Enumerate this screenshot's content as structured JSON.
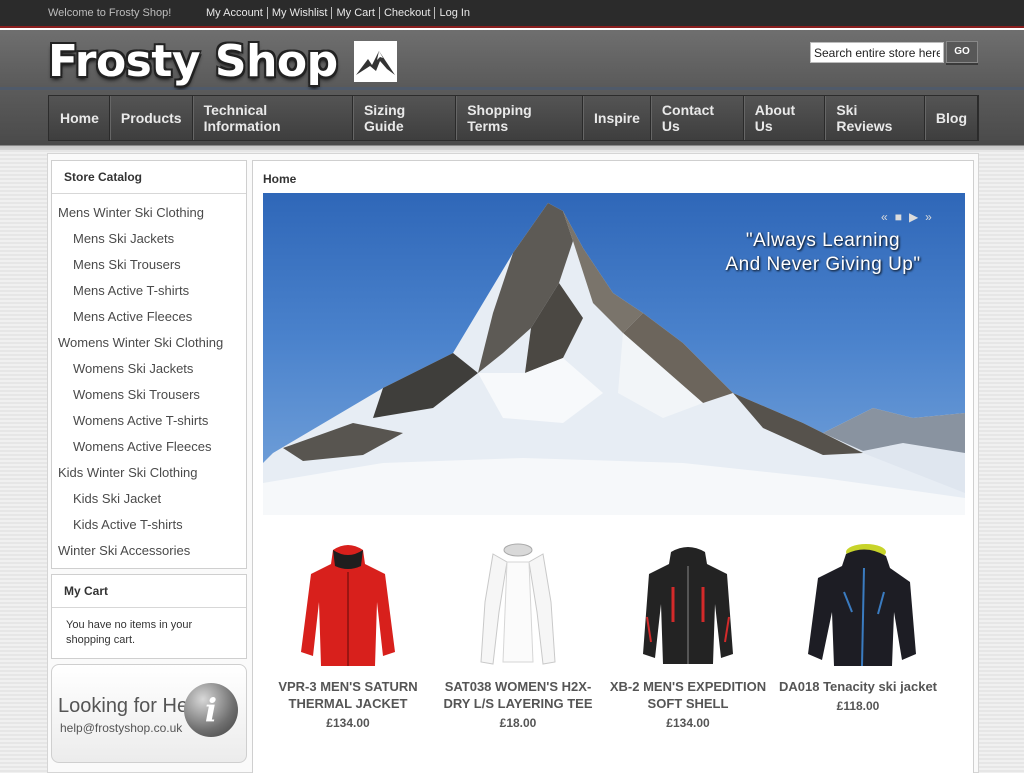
{
  "topbar": {
    "welcome": "Welcome to Frosty Shop!",
    "links": [
      "My Account",
      "My Wishlist",
      "My Cart",
      "Checkout",
      "Log In"
    ]
  },
  "header": {
    "logo_text": "Frosty Shop",
    "search_placeholder": "Search entire store here...",
    "search_value": "Search entire store here",
    "search_button": "GO"
  },
  "nav": {
    "items": [
      "Home",
      "Products",
      "Technical Information",
      "Sizing Guide",
      "Shopping Terms",
      "Inspire",
      "Contact Us",
      "About Us",
      "Ski Reviews",
      "Blog"
    ]
  },
  "sidebar": {
    "catalog_title": "Store Catalog",
    "catalog": [
      {
        "label": "Mens Winter Ski Clothing",
        "level": "top"
      },
      {
        "label": "Mens Ski Jackets",
        "level": "sub"
      },
      {
        "label": "Mens Ski Trousers",
        "level": "sub"
      },
      {
        "label": "Mens Active T-shirts",
        "level": "sub"
      },
      {
        "label": "Mens Active Fleeces",
        "level": "sub"
      },
      {
        "label": "Womens Winter Ski Clothing",
        "level": "top"
      },
      {
        "label": "Womens Ski Jackets",
        "level": "sub"
      },
      {
        "label": "Womens Ski Trousers",
        "level": "sub"
      },
      {
        "label": "Womens Active T-shirts",
        "level": "sub"
      },
      {
        "label": "Womens Active Fleeces",
        "level": "sub"
      },
      {
        "label": "Kids Winter Ski Clothing",
        "level": "top"
      },
      {
        "label": "Kids Ski Jacket",
        "level": "sub"
      },
      {
        "label": "Kids Active T-shirts",
        "level": "sub"
      },
      {
        "label": "Winter Ski Accessories",
        "level": "top"
      }
    ],
    "cart_title": "My Cart",
    "cart_text": "You have no items in your shopping cart.",
    "help_title": "Looking for Help",
    "help_email": "help@frostyshop.co.uk",
    "help_icon": "i"
  },
  "main": {
    "breadcrumb": "Home",
    "banner_quote_line1": "\"Always Learning",
    "banner_quote_line2": "And Never Giving Up\"",
    "slider_controls": [
      "«",
      "■",
      "▶",
      "»"
    ]
  },
  "products": [
    {
      "name": "VPR-3 MEN'S SATURN THERMAL JACKET",
      "price": "£134.00",
      "color": "#d8201c",
      "icon": "red-jacket"
    },
    {
      "name": "SAT038 WOMEN'S H2X-DRY L/S LAYERING TEE",
      "price": "£18.00",
      "color": "#f2f2f2",
      "icon": "white-layering-tee"
    },
    {
      "name": "XB-2 MEN'S EXPEDITION SOFT SHELL",
      "price": "£134.00",
      "color": "#222222",
      "icon": "black-soft-shell"
    },
    {
      "name": "DA018 Tenacity ski jacket",
      "price": "£118.00",
      "color": "#1d1d24",
      "icon": "black-ski-jacket"
    }
  ]
}
